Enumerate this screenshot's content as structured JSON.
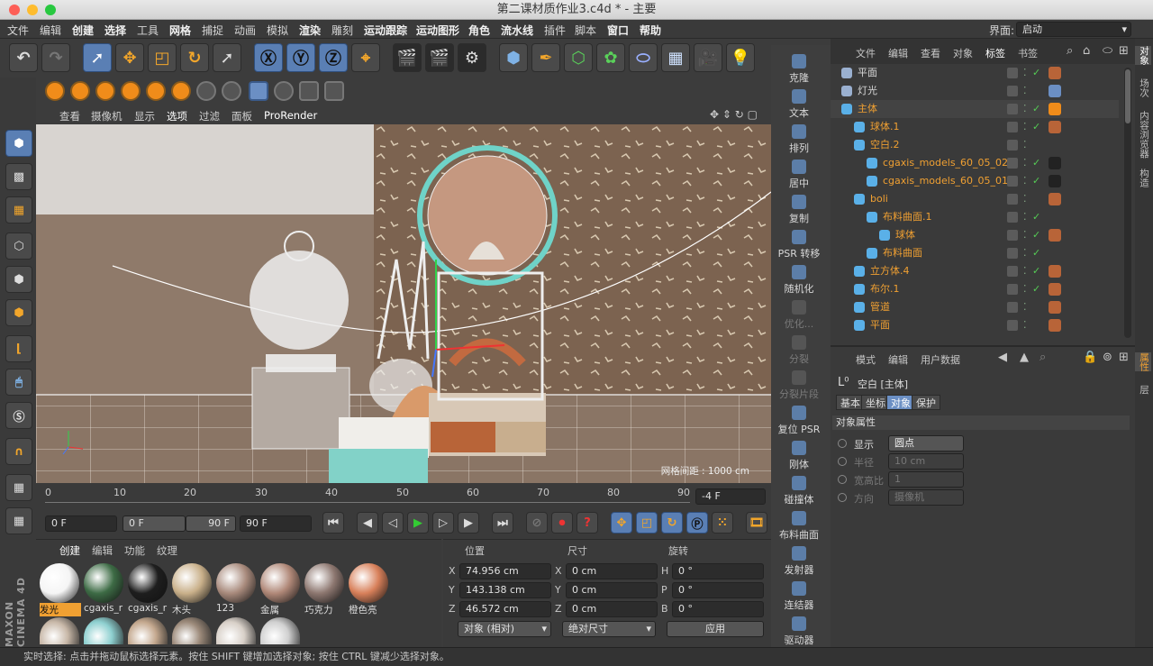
{
  "window": {
    "title": "第二课材质作业3.c4d * - 主要"
  },
  "menubar": {
    "items": [
      "文件",
      "编辑",
      "创建",
      "选择",
      "工具",
      "网格",
      "捕捉",
      "动画",
      "模拟",
      "渲染",
      "雕刻",
      "运动跟踪",
      "运动图形",
      "角色",
      "流水线",
      "插件",
      "脚本",
      "窗口",
      "帮助"
    ],
    "layout_label": "界面:",
    "layout_value": "启动"
  },
  "viewport": {
    "menu": [
      "查看",
      "摄像机",
      "显示",
      "选项",
      "过滤",
      "面板",
      "ProRender"
    ],
    "grid_spacing": "网格间距 : 1000 cm"
  },
  "timeline": {
    "ticks": [
      "0",
      "10",
      "20",
      "30",
      "40",
      "50",
      "60",
      "70",
      "80",
      "90"
    ],
    "current_frame": "-4 F",
    "start": "0 F",
    "range_start": "0 F",
    "range_end": "90 F",
    "end": "90 F"
  },
  "commands": [
    {
      "label": "克隆",
      "enabled": true
    },
    {
      "label": "文本",
      "enabled": true
    },
    {
      "label": "排列",
      "enabled": true
    },
    {
      "label": "居中",
      "enabled": true
    },
    {
      "label": "复制",
      "enabled": true
    },
    {
      "label": "PSR 转移",
      "enabled": true
    },
    {
      "label": "随机化",
      "enabled": true
    },
    {
      "label": "优化...",
      "enabled": false
    },
    {
      "label": "分裂",
      "enabled": false
    },
    {
      "label": "分裂片段",
      "enabled": false
    },
    {
      "label": "复位 PSR",
      "enabled": true
    },
    {
      "label": "刚体",
      "enabled": true
    },
    {
      "label": "碰撞体",
      "enabled": true
    },
    {
      "label": "布料曲面",
      "enabled": true
    },
    {
      "label": "发射器",
      "enabled": true
    },
    {
      "label": "连结器",
      "enabled": true
    },
    {
      "label": "驱动器",
      "enabled": true
    }
  ],
  "object_manager": {
    "menu": [
      "文件",
      "编辑",
      "查看",
      "对象",
      "标签",
      "书签"
    ],
    "rows": [
      {
        "name": "平面",
        "color": "#d8d8d8",
        "indent": 0
      },
      {
        "name": "灯光",
        "color": "#d8d8d8",
        "indent": 0
      },
      {
        "name": "主体",
        "color": "#f0a032",
        "indent": 0
      },
      {
        "name": "球体.1",
        "color": "#f0a032",
        "indent": 1
      },
      {
        "name": "空白.2",
        "color": "#f0a032",
        "indent": 1
      },
      {
        "name": "cgaxis_models_60_05_02",
        "color": "#f0a032",
        "indent": 2
      },
      {
        "name": "cgaxis_models_60_05_01",
        "color": "#f0a032",
        "indent": 2
      },
      {
        "name": "boli",
        "color": "#f0a032",
        "indent": 1
      },
      {
        "name": "布料曲面.1",
        "color": "#f0a032",
        "indent": 2
      },
      {
        "name": "球体",
        "color": "#f0a032",
        "indent": 3
      },
      {
        "name": "布料曲面",
        "color": "#f0a032",
        "indent": 2
      },
      {
        "name": "立方体.4",
        "color": "#f0a032",
        "indent": 1
      },
      {
        "name": "布尔.1",
        "color": "#f0a032",
        "indent": 1
      },
      {
        "name": "管道",
        "color": "#f0a032",
        "indent": 1
      },
      {
        "name": "平面",
        "color": "#f0a032",
        "indent": 1
      }
    ]
  },
  "attributes": {
    "menu": [
      "模式",
      "编辑",
      "用户数据"
    ],
    "object_title": "空白 [主体]",
    "tabs": [
      "基本",
      "坐标",
      "对象",
      "保护"
    ],
    "section": "对象属性",
    "fields": [
      {
        "label": "显示",
        "value": "圆点"
      },
      {
        "label": "半径",
        "value": "10 cm"
      },
      {
        "label": "宽高比",
        "value": "1"
      },
      {
        "label": "方向",
        "value": "摄像机"
      }
    ]
  },
  "right_tabs": [
    "对象",
    "场次",
    "内容浏览器",
    "构造"
  ],
  "right_tabs_lower": [
    "属性",
    "层"
  ],
  "material_manager": {
    "menu": [
      "创建",
      "编辑",
      "功能",
      "纹理"
    ],
    "materials": [
      {
        "name": "发光",
        "color": "#f5f5f5"
      },
      {
        "name": "cgaxis_r",
        "color": "#3d6b45"
      },
      {
        "name": "cgaxis_r",
        "color": "#1e1e1e"
      },
      {
        "name": "木头",
        "color": "#c9b08a"
      },
      {
        "name": "123",
        "color": "#a88a7c"
      },
      {
        "name": "金属",
        "color": "#b08878"
      },
      {
        "name": "巧克力",
        "color": "#8d7770"
      },
      {
        "name": "橙色亮",
        "color": "#d8805a"
      }
    ]
  },
  "coords": {
    "headers": [
      "位置",
      "尺寸",
      "旋转"
    ],
    "rows": [
      {
        "axis": "X",
        "pos": "74.956 cm",
        "s_axis": "X",
        "size": "0 cm",
        "r_axis": "H",
        "rot": "0 °"
      },
      {
        "axis": "Y",
        "pos": "143.138 cm",
        "s_axis": "Y",
        "size": "0 cm",
        "r_axis": "P",
        "rot": "0 °"
      },
      {
        "axis": "Z",
        "pos": "46.572 cm",
        "s_axis": "Z",
        "size": "0 cm",
        "r_axis": "B",
        "rot": "0 °"
      }
    ],
    "mode": "对象 (相对)",
    "size_mode": "绝对尺寸",
    "apply": "应用"
  },
  "status": {
    "text": "实时选择: 点击并拖动鼠标选择元素。按住 SHIFT 键增加选择对象; 按住 CTRL 键减少选择对象。"
  },
  "logo": {
    "text": "MAXON CINEMA 4D"
  }
}
